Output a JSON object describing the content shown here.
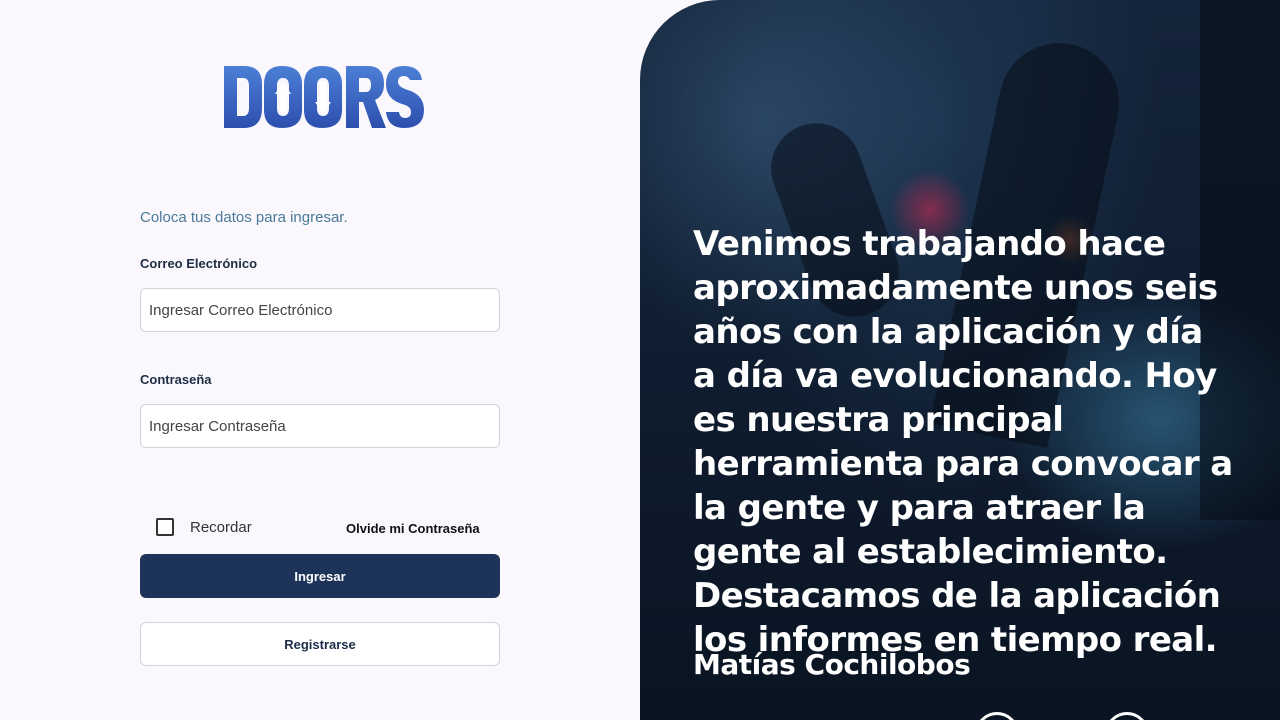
{
  "brand": {
    "logo_text": "DOORS"
  },
  "form": {
    "intro": "Coloca tus datos para ingresar.",
    "email_label": "Correo Electrónico",
    "email_placeholder": "Ingresar Correo Electrónico",
    "password_label": "Contraseña",
    "password_placeholder": "Ingresar Contraseña",
    "remember_label": "Recordar",
    "forgot_label": "Olvide mi Contraseña",
    "submit_label": "Ingresar",
    "register_label": "Registrarse"
  },
  "testimonial": {
    "quote": "Venimos trabajando hace aproximadamente unos seis años con la aplicación y día a día va evolucionando. Hoy es nuestra principal herramienta para convocar a la gente y para atraer la gente al establecimiento. Destacamos de la aplicación los informes en tiempo real.",
    "author": "Matías Cochilobos"
  },
  "colors": {
    "primary": "#1d3359",
    "logo_blue": "#3a66c4",
    "intro_text": "#4a7a9a"
  }
}
